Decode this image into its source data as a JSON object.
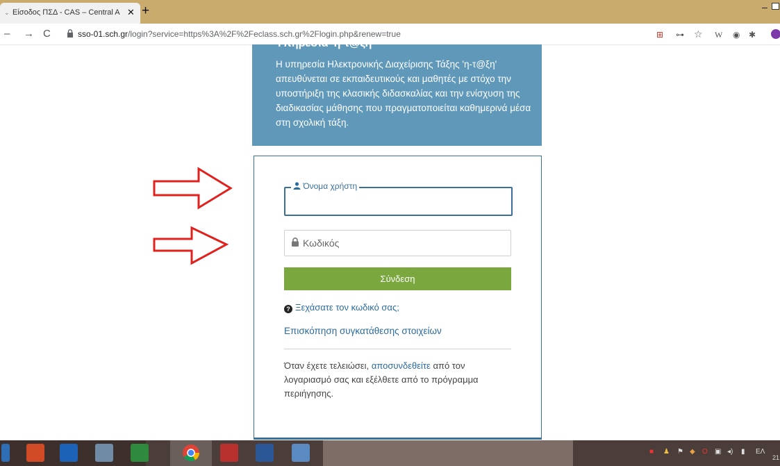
{
  "browser": {
    "tab_title": "Είσοδος ΠΣΔ - CAS – Central Aut",
    "url_domain": "sso-01.sch.gr",
    "url_rest": "/login?service=https%3A%2F%2Feclass.sch.gr%2Flogin.php&renew=true"
  },
  "info": {
    "title": "Υπηρεσία 'η-τ@ξη'",
    "text": "Η υπηρεσία Ηλεκτρονικής Διαχείρισης Τάξης 'η-τ@ξη' απευθύνεται σε εκπαιδευτικούς και μαθητές με στόχο την υποστήριξη της κλασικής διδασκαλίας και την ενίσχυση της διαδικασίας μάθησης που πραγματοποιείται καθημερινά μέσα στη σχολική τάξη."
  },
  "login": {
    "username_label": "Όνομα χρήστη",
    "password_placeholder": "Κωδικός",
    "submit_label": "Σύνδεση",
    "forgot_link": "Ξεχάσατε τον κωδικό σας;",
    "consent_link": "Επισκόπηση συγκατάθεσης στοιχείων",
    "note_before": "Όταν έχετε τελειώσει, ",
    "note_link": "αποσυνδεθείτε",
    "note_after": " από τον λογαριασμό σας και εξέλθετε από το πρόγραμμα περιήγησης."
  },
  "taskbar": {
    "language": "ΕΛ",
    "clock_partial": "21"
  },
  "colors": {
    "tabstrip": "#c9ab6d",
    "info_panel": "#5f98b9",
    "primary_border": "#3a6f9a",
    "login_button": "#7aa83f",
    "annotation_arrow": "#e0221f"
  }
}
